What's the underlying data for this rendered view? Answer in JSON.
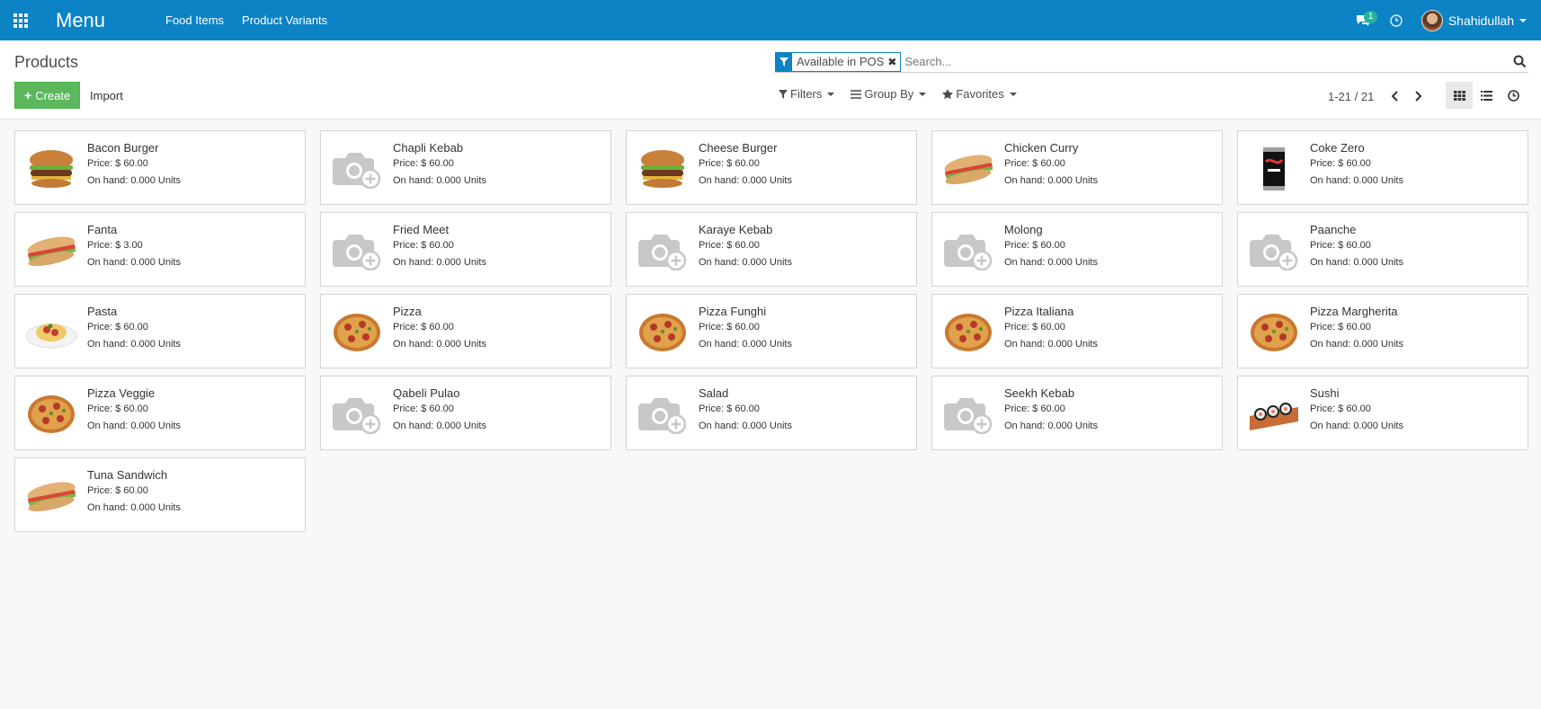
{
  "navbar": {
    "brand": "Menu",
    "menus": [
      "Food Items",
      "Product Variants"
    ],
    "messages_count": "1",
    "user_name": "Shahidullah"
  },
  "control": {
    "breadcrumb": "Products",
    "create_label": "Create",
    "import_label": "Import",
    "facet_label": "Available in POS",
    "search_placeholder": "Search...",
    "filters_label": "Filters",
    "groupby_label": "Group By",
    "favorites_label": "Favorites",
    "pager_value": "1-21 / 21"
  },
  "products": [
    {
      "name": "Bacon Burger",
      "price": "Price: $ 60.00",
      "stock": "On hand: 0.000 Units",
      "image": "burger"
    },
    {
      "name": "Chapli Kebab",
      "price": "Price: $ 60.00",
      "stock": "On hand: 0.000 Units",
      "image": "placeholder"
    },
    {
      "name": "Cheese Burger",
      "price": "Price: $ 60.00",
      "stock": "On hand: 0.000 Units",
      "image": "burger"
    },
    {
      "name": "Chicken Curry",
      "price": "Price: $ 60.00",
      "stock": "On hand: 0.000 Units",
      "image": "sandwich"
    },
    {
      "name": "Coke Zero",
      "price": "Price: $ 60.00",
      "stock": "On hand: 0.000 Units",
      "image": "can"
    },
    {
      "name": "Fanta",
      "price": "Price: $ 3.00",
      "stock": "On hand: 0.000 Units",
      "image": "sandwich"
    },
    {
      "name": "Fried Meet",
      "price": "Price: $ 60.00",
      "stock": "On hand: 0.000 Units",
      "image": "placeholder"
    },
    {
      "name": "Karaye Kebab",
      "price": "Price: $ 60.00",
      "stock": "On hand: 0.000 Units",
      "image": "placeholder"
    },
    {
      "name": "Molong",
      "price": "Price: $ 60.00",
      "stock": "On hand: 0.000 Units",
      "image": "placeholder"
    },
    {
      "name": "Paanche",
      "price": "Price: $ 60.00",
      "stock": "On hand: 0.000 Units",
      "image": "placeholder"
    },
    {
      "name": "Pasta",
      "price": "Price: $ 60.00",
      "stock": "On hand: 0.000 Units",
      "image": "pasta"
    },
    {
      "name": "Pizza",
      "price": "Price: $ 60.00",
      "stock": "On hand: 0.000 Units",
      "image": "pizza"
    },
    {
      "name": "Pizza Funghi",
      "price": "Price: $ 60.00",
      "stock": "On hand: 0.000 Units",
      "image": "pizza"
    },
    {
      "name": "Pizza Italiana",
      "price": "Price: $ 60.00",
      "stock": "On hand: 0.000 Units",
      "image": "pizza"
    },
    {
      "name": "Pizza Margherita",
      "price": "Price: $ 60.00",
      "stock": "On hand: 0.000 Units",
      "image": "pizza"
    },
    {
      "name": "Pizza Veggie",
      "price": "Price: $ 60.00",
      "stock": "On hand: 0.000 Units",
      "image": "pizza"
    },
    {
      "name": "Qabeli Pulao",
      "price": "Price: $ 60.00",
      "stock": "On hand: 0.000 Units",
      "image": "placeholder"
    },
    {
      "name": "Salad",
      "price": "Price: $ 60.00",
      "stock": "On hand: 0.000 Units",
      "image": "placeholder"
    },
    {
      "name": "Seekh Kebab",
      "price": "Price: $ 60.00",
      "stock": "On hand: 0.000 Units",
      "image": "placeholder"
    },
    {
      "name": "Sushi",
      "price": "Price: $ 60.00",
      "stock": "On hand: 0.000 Units",
      "image": "sushi"
    },
    {
      "name": "Tuna Sandwich",
      "price": "Price: $ 60.00",
      "stock": "On hand: 0.000 Units",
      "image": "sandwich"
    }
  ]
}
